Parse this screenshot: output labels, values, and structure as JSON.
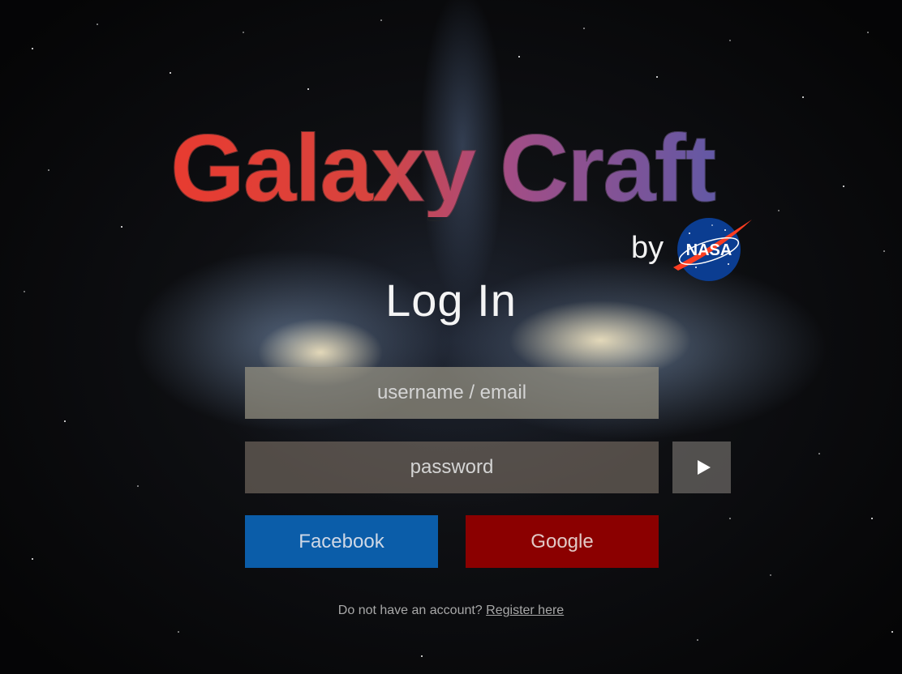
{
  "app": {
    "title": "Galaxy Craft",
    "by_label": "by",
    "brand_logo_text": "NASA"
  },
  "login": {
    "heading": "Log In",
    "username_placeholder": "username / email",
    "password_placeholder": "password",
    "submit_icon": "play-icon",
    "facebook_label": "Facebook",
    "google_label": "Google",
    "register_prompt": "Do not have an account?",
    "register_link": "Register here"
  },
  "colors": {
    "facebook": "#0b5da9",
    "google": "#8b0000",
    "title_gradient_start": "#e83b30",
    "title_gradient_end": "#5c5aa8"
  }
}
